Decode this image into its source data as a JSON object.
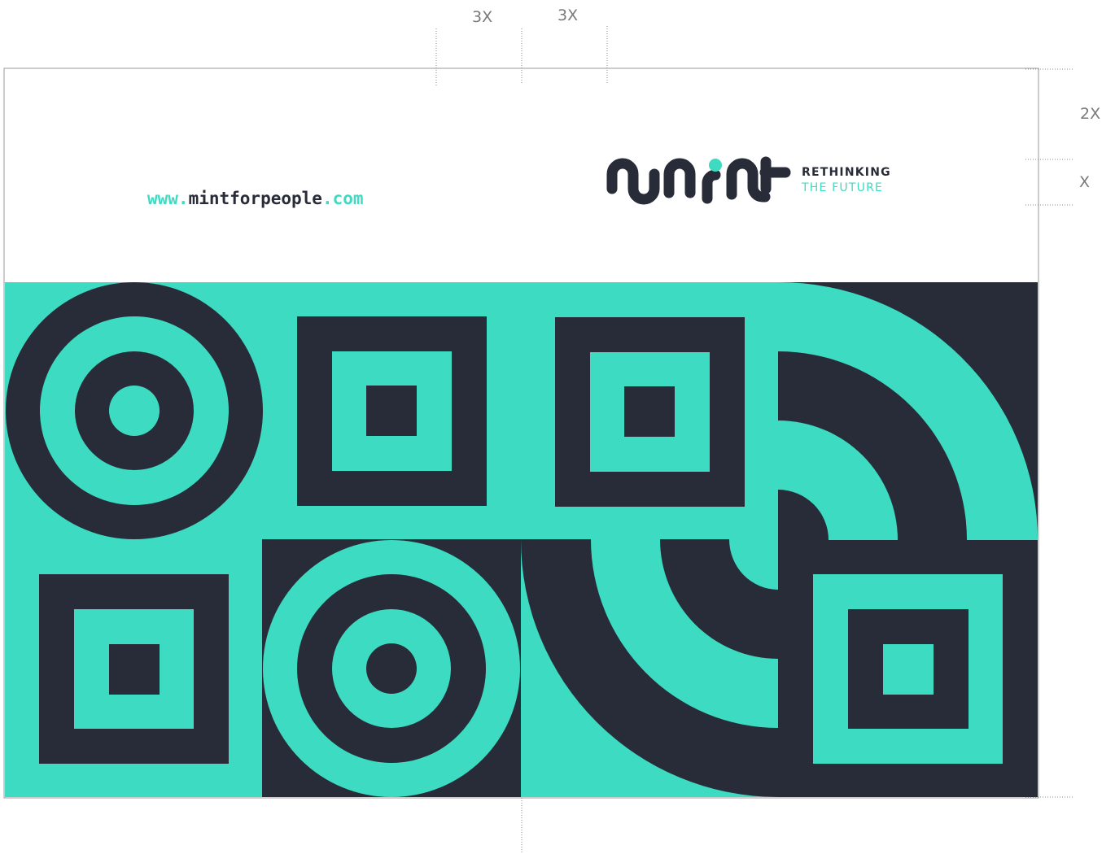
{
  "dimensions": {
    "top_left": "3X",
    "top_right": "3X",
    "side_top": "2X",
    "side_bottom": "X"
  },
  "url": {
    "prefix": "www.",
    "domain": "mintforpeople",
    "dot": ".",
    "tld": "com"
  },
  "brand": {
    "tagline_line1": "RETHINKING",
    "tagline_line2": "THE FUTURE"
  },
  "colors": {
    "mint": "#3ddbc1",
    "dark": "#282c38",
    "guide": "#9a9a9a"
  }
}
